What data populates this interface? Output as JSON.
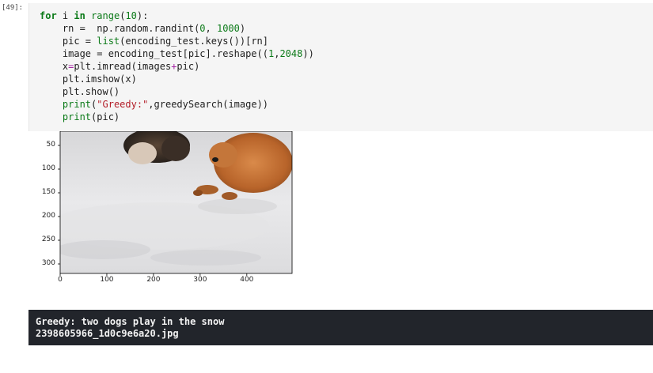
{
  "cell": {
    "prompt": "[49]:",
    "lines": [
      {
        "parts": [
          {
            "t": "for",
            "c": "kw"
          },
          {
            "t": " i ",
            "c": ""
          },
          {
            "t": "in",
            "c": "kw"
          },
          {
            "t": " ",
            "c": ""
          },
          {
            "t": "range",
            "c": "bi"
          },
          {
            "t": "(",
            "c": ""
          },
          {
            "t": "10",
            "c": "num"
          },
          {
            "t": "):",
            "c": ""
          }
        ]
      },
      {
        "parts": [
          {
            "t": "    rn =  np.random.randint(",
            "c": ""
          },
          {
            "t": "0",
            "c": "num"
          },
          {
            "t": ", ",
            "c": ""
          },
          {
            "t": "1000",
            "c": "num"
          },
          {
            "t": ")",
            "c": ""
          }
        ]
      },
      {
        "parts": [
          {
            "t": "    pic = ",
            "c": ""
          },
          {
            "t": "list",
            "c": "bi"
          },
          {
            "t": "(encoding_test.keys())[rn]",
            "c": ""
          }
        ]
      },
      {
        "parts": [
          {
            "t": "    image = encoding_test[pic].reshape((",
            "c": ""
          },
          {
            "t": "1",
            "c": "num"
          },
          {
            "t": ",",
            "c": ""
          },
          {
            "t": "2048",
            "c": "num"
          },
          {
            "t": "))",
            "c": ""
          }
        ]
      },
      {
        "parts": [
          {
            "t": "    x",
            "c": ""
          },
          {
            "t": "=",
            "c": "op"
          },
          {
            "t": "plt.imread(images",
            "c": ""
          },
          {
            "t": "+",
            "c": "op"
          },
          {
            "t": "pic)",
            "c": ""
          }
        ]
      },
      {
        "parts": [
          {
            "t": "    plt.imshow(x)",
            "c": ""
          }
        ]
      },
      {
        "parts": [
          {
            "t": "    plt.show()",
            "c": ""
          }
        ]
      },
      {
        "parts": [
          {
            "t": "    ",
            "c": ""
          },
          {
            "t": "print",
            "c": "bi"
          },
          {
            "t": "(",
            "c": ""
          },
          {
            "t": "\"Greedy:\"",
            "c": "str"
          },
          {
            "t": ",greedySearch(image))",
            "c": ""
          }
        ]
      },
      {
        "parts": [
          {
            "t": "    ",
            "c": ""
          },
          {
            "t": "print",
            "c": "bi"
          },
          {
            "t": "(pic)",
            "c": ""
          }
        ]
      }
    ]
  },
  "plot": {
    "y_ticks": [
      "50",
      "100",
      "150",
      "200",
      "250",
      "300"
    ],
    "x_ticks": [
      "0",
      "100",
      "200",
      "300",
      "400"
    ]
  },
  "output": {
    "line1": "Greedy: two dogs play in the snow",
    "line2": "2398605966_1d0c9e6a20.jpg"
  }
}
